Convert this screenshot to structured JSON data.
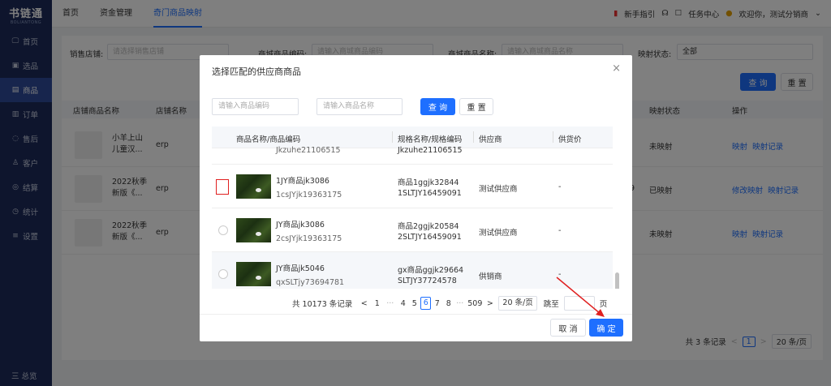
{
  "sidebar": {
    "logo_main": "书链通",
    "logo_sub": "BOLIANTONG",
    "items": [
      {
        "icon": "monitor-icon",
        "glyph": "🖵",
        "label": "首页"
      },
      {
        "icon": "package-icon",
        "glyph": "▣",
        "label": "选品"
      },
      {
        "icon": "goods-icon",
        "glyph": "▤",
        "label": "商品"
      },
      {
        "icon": "order-icon",
        "glyph": "▥",
        "label": "订单"
      },
      {
        "icon": "aftersale-icon",
        "glyph": "◌",
        "label": "售后"
      },
      {
        "icon": "customer-icon",
        "glyph": "♙",
        "label": "客户"
      },
      {
        "icon": "settle-icon",
        "glyph": "◎",
        "label": "结算"
      },
      {
        "icon": "stats-icon",
        "glyph": "◷",
        "label": "统计"
      },
      {
        "icon": "settings-icon",
        "glyph": "≡",
        "label": "设置"
      }
    ],
    "bottom": "三 总览"
  },
  "topbar": {
    "tabs": [
      "首页",
      "资金管理",
      "奇门商品映射"
    ],
    "guide": "新手指引",
    "task": "任务中心",
    "welcome": "欢迎你，测试分销商"
  },
  "filter": {
    "shop_label": "销售店铺:",
    "shop_placeholder": "请选择销售店铺",
    "code_label": "商城商品编码:",
    "code_placeholder": "请输入商城商品编码",
    "name_label": "商城商品名称:",
    "name_placeholder": "请输入商城商品名称",
    "status_label": "映射状态:",
    "status_value": "全部",
    "search_btn": "查 询",
    "reset_btn": "重 置"
  },
  "main_table": {
    "headers": [
      "店铺商品名称",
      "店铺名称",
      "映射状态",
      "操作"
    ],
    "rows": [
      {
        "name": "小羊上山儿童汉...",
        "shop": "erp",
        "status": "未映射",
        "op1": "映射",
        "op2": "映射记录",
        "extra": ""
      },
      {
        "name": "2022秋季新版《...",
        "shop": "erp",
        "status": "已映射",
        "op1": "修改映射",
        "op2": "映射记录",
        "extra": "9"
      },
      {
        "name": "2022秋季新版《...",
        "shop": "erp",
        "status": "未映射",
        "op1": "映射",
        "op2": "映射记录",
        "extra": ""
      }
    ],
    "pager_total": "共 3 条记录",
    "pager_page": "1",
    "pager_size": "20 条/页"
  },
  "dialog": {
    "title": "选择匹配的供应商商品",
    "close": "×",
    "code_placeholder": "请输入商品编码",
    "name_placeholder": "请输入商品名称",
    "search_btn": "查 询",
    "reset_btn": "重 置",
    "headers": [
      "商品名称/商品编码",
      "规格名称/规格编码",
      "供应商",
      "供货价"
    ],
    "partial_row": {
      "code": "Jkzuhe21106515",
      "spec": "Jkzuhe21106515"
    },
    "rows": [
      {
        "name": "1JY商品jk3086",
        "code": "1csJYjk19363175",
        "spec_name": "商品1ggjk32844",
        "spec_code": "1SLTJY16459091",
        "supplier": "测试供应商",
        "price": "-"
      },
      {
        "name": "JY商品jk3086",
        "code": "2csJYjk19363175",
        "spec_name": "商品2ggjk20584",
        "spec_code": "2SLTJY16459091",
        "supplier": "测试供应商",
        "price": "-"
      },
      {
        "name": "JY商品jk5046",
        "code": "qxSLTjy73694781",
        "spec_name": "gx商品ggjk29664",
        "spec_code": "SLTJY37724578",
        "supplier": "供销商",
        "price": "-"
      }
    ],
    "pager": {
      "total": "共 10173 条记录",
      "prev": "<",
      "pages": [
        "1",
        "···",
        "4",
        "5",
        "6",
        "7",
        "8",
        "···",
        "509"
      ],
      "current": "6",
      "next": ">",
      "size": "20 条/页",
      "jump_label": "跳至",
      "jump_unit": "页"
    },
    "cancel_btn": "取 消",
    "ok_btn": "确 定"
  },
  "colors": {
    "primary": "#1e6fff",
    "sidebar": "#1d2b5a",
    "annotation": "#e02020"
  }
}
